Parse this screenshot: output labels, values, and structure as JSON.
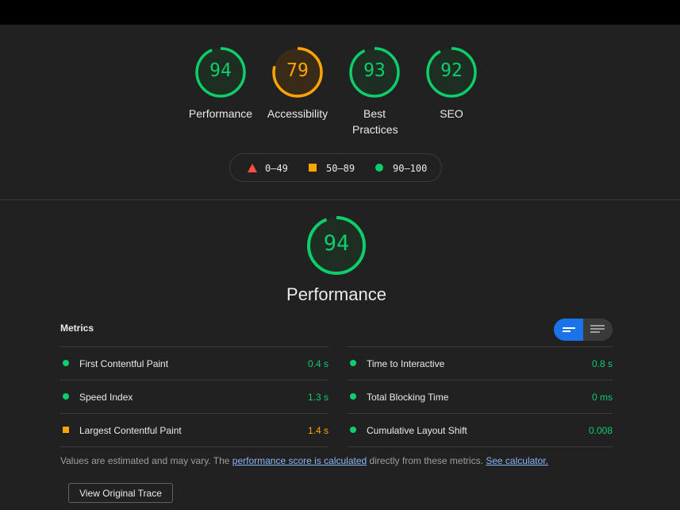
{
  "colors": {
    "pass": "#0cce6b",
    "average": "#ffa400",
    "fail": "#ff4e42",
    "link": "#8ab4f8"
  },
  "categories": [
    {
      "score": "94",
      "label": "Performance",
      "rating": "pass"
    },
    {
      "score": "79",
      "label": "Accessibility",
      "rating": "average"
    },
    {
      "score": "93",
      "label": "Best Practices",
      "rating": "pass"
    },
    {
      "score": "92",
      "label": "SEO",
      "rating": "pass"
    }
  ],
  "legend": {
    "fail": "0–49",
    "average": "50–89",
    "pass": "90–100"
  },
  "main": {
    "score": "94",
    "title": "Performance"
  },
  "metrics": {
    "title": "Metrics",
    "left": [
      {
        "name": "First Contentful Paint",
        "value": "0.4 s",
        "rating": "pass"
      },
      {
        "name": "Speed Index",
        "value": "1.3 s",
        "rating": "pass"
      },
      {
        "name": "Largest Contentful Paint",
        "value": "1.4 s",
        "rating": "average"
      }
    ],
    "right": [
      {
        "name": "Time to Interactive",
        "value": "0.8 s",
        "rating": "pass"
      },
      {
        "name": "Total Blocking Time",
        "value": "0 ms",
        "rating": "pass"
      },
      {
        "name": "Cumulative Layout Shift",
        "value": "0.008",
        "rating": "pass"
      }
    ]
  },
  "note": {
    "prefix": "Values are estimated and may vary. The ",
    "link1": "performance score is calculated",
    "middle": " directly from these metrics. ",
    "link2": "See calculator."
  },
  "trace_button": "View Original Trace"
}
